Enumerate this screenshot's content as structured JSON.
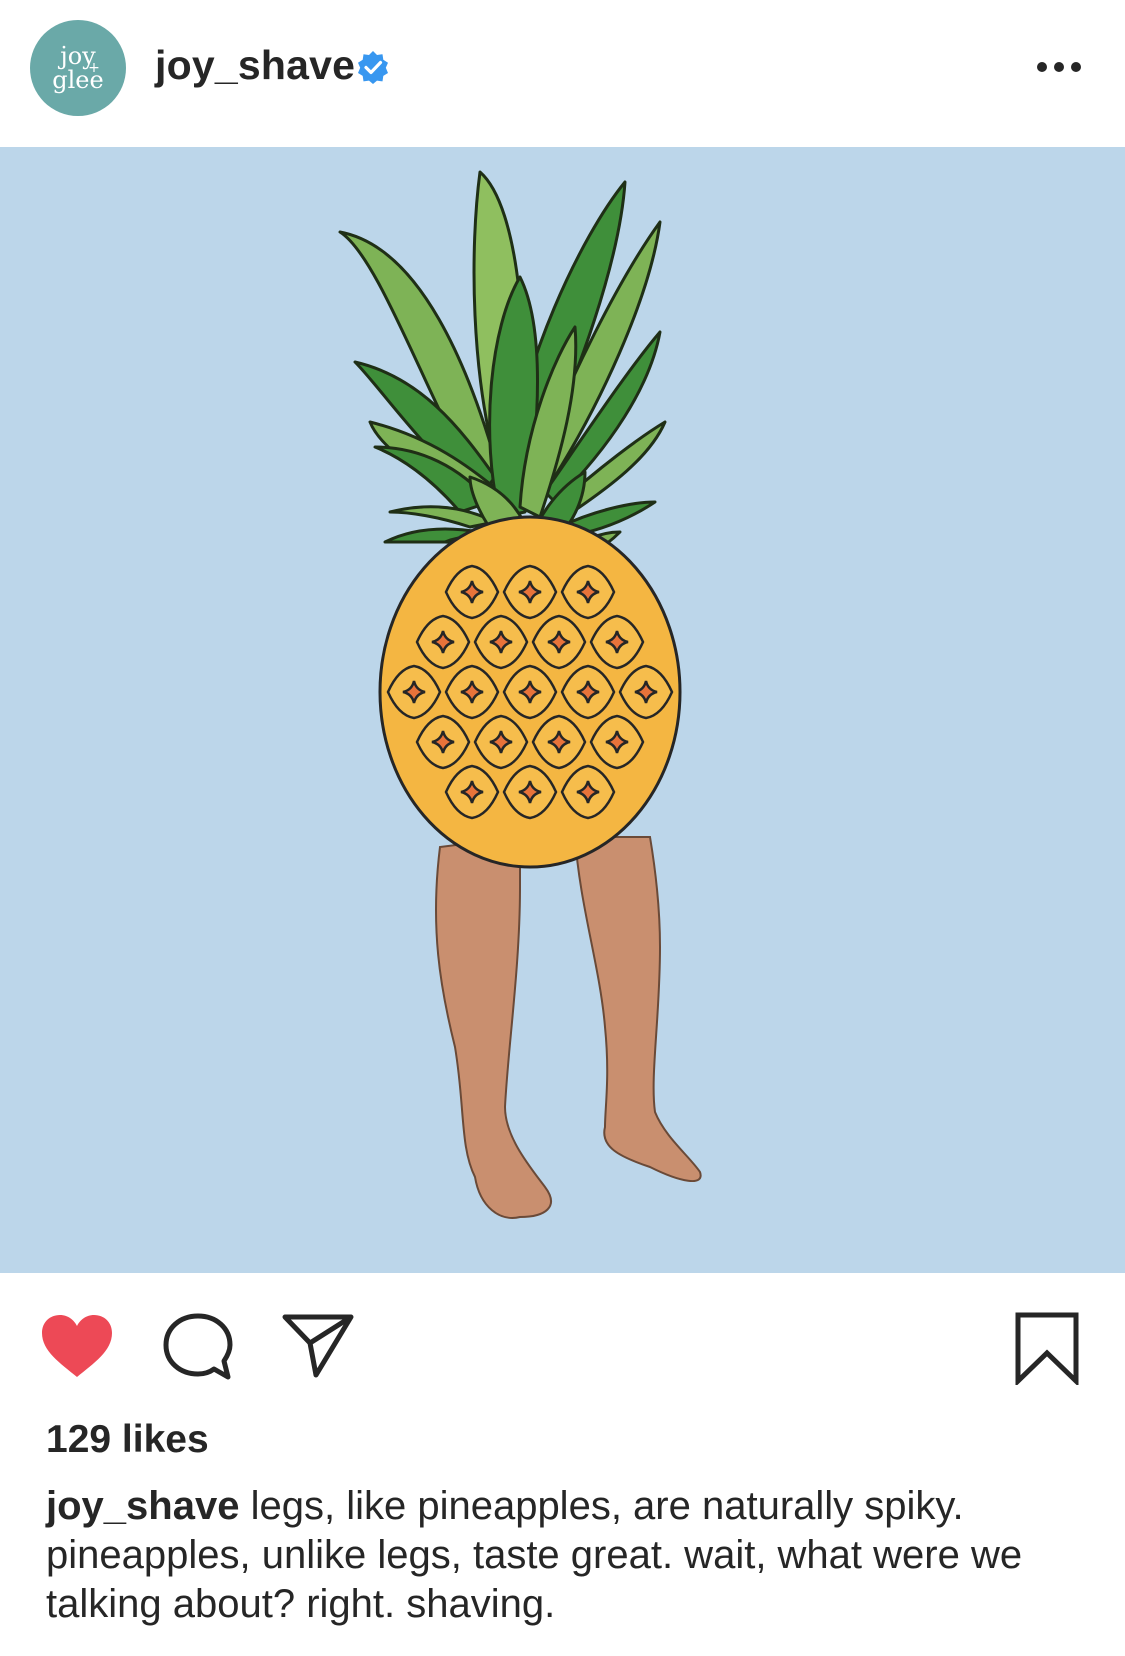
{
  "post": {
    "avatar_text_line1": "joy",
    "avatar_text_line2": "glee",
    "username": "joy_shave",
    "verified": true,
    "liked": true,
    "likes_text": "129 likes",
    "caption_username": "joy_shave",
    "caption_text": " legs, like pineapples, are naturally spiky. pineapples, unlike legs, taste great. wait, what were we talking about? right. shaving."
  },
  "icons": {
    "verified": "verified-badge-icon",
    "more": "more-options-icon",
    "like": "heart-icon",
    "comment": "comment-icon",
    "share": "share-icon",
    "save": "bookmark-icon"
  },
  "colors": {
    "heart": "#ed4956",
    "verified": "#3897f0",
    "image_background": "#bcd6ea",
    "avatar": "#6aa9a8"
  }
}
